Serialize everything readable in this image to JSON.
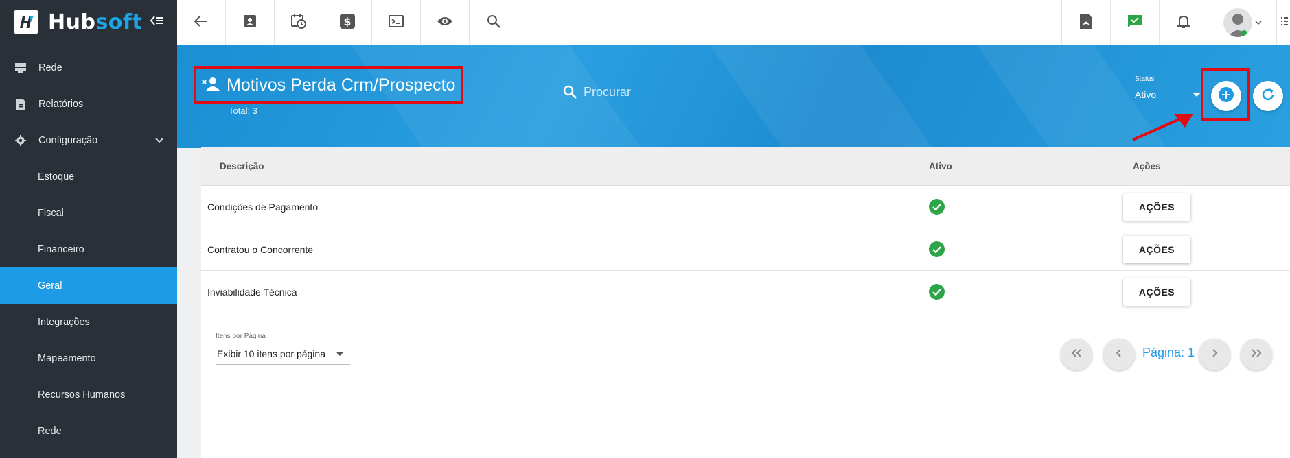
{
  "brand": {
    "name_part1": "Hub",
    "name_part2": "soft"
  },
  "sidebar": {
    "items": [
      {
        "label": "Rede",
        "icon": "server-icon",
        "sub": false
      },
      {
        "label": "Relatórios",
        "icon": "document-icon",
        "sub": false
      },
      {
        "label": "Configuração",
        "icon": "gear-icon",
        "sub": false,
        "expanded": true
      },
      {
        "label": "Estoque",
        "sub": true
      },
      {
        "label": "Fiscal",
        "sub": true
      },
      {
        "label": "Financeiro",
        "sub": true
      },
      {
        "label": "Geral",
        "sub": true,
        "active": true
      },
      {
        "label": "Integrações",
        "sub": true
      },
      {
        "label": "Mapeamento",
        "sub": true
      },
      {
        "label": "Recursos Humanos",
        "sub": true
      },
      {
        "label": "Rede",
        "sub": true
      }
    ]
  },
  "topbar": {
    "left_icons": [
      "back-arrow-icon",
      "contact-card-icon",
      "calendar-clock-icon",
      "dollar-icon",
      "terminal-icon",
      "eye-icon",
      "search-icon"
    ],
    "right_icons": [
      "pdf-icon",
      "chat-check-icon",
      "bell-icon"
    ]
  },
  "header": {
    "title": "Motivos Perda Crm/Prospecto",
    "total": "Total: 3",
    "search_placeholder": "Procurar",
    "status_label": "Status",
    "status_value": "Ativo"
  },
  "table": {
    "columns": [
      "Descrição",
      "Ativo",
      "Ações"
    ],
    "rows": [
      {
        "descricao": "Condições de Pagamento",
        "ativo": true,
        "acoes": "AÇÕES"
      },
      {
        "descricao": "Contratou o Concorrente",
        "ativo": true,
        "acoes": "AÇÕES"
      },
      {
        "descricao": "Inviabilidade Técnica",
        "ativo": true,
        "acoes": "AÇÕES"
      }
    ]
  },
  "pagination": {
    "per_page_label": "Itens por Página",
    "per_page_value": "Exibir 10 itens por página",
    "page_label": "Página: 1"
  },
  "colors": {
    "accent": "#1e9be6",
    "sidebar": "#293038",
    "highlight": "#e10b14",
    "success": "#2fa54a"
  }
}
